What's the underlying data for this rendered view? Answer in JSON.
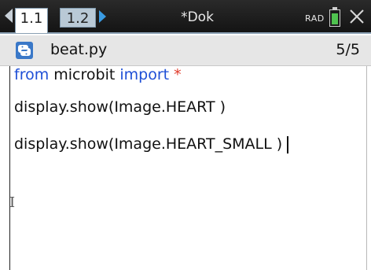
{
  "tabs": [
    {
      "label": "1.1",
      "active": true
    },
    {
      "label": "1.2",
      "active": false
    }
  ],
  "document": {
    "title": "*Dok"
  },
  "status": {
    "angle_mode": "RAD",
    "battery_color": "#4fc24f"
  },
  "file": {
    "icon": "python-icon",
    "name": "beat.py",
    "page_count": "5/5"
  },
  "editor": {
    "line1_keyword_from": "from",
    "line1_module": " microbit ",
    "line1_keyword_import": "import",
    "line1_star": " *",
    "line2": "display.show(Image.HEART )",
    "line3": "display.show(Image.HEART_SMALL )"
  },
  "colors": {
    "keyword": "#1e4fd6",
    "star": "#e03a2a",
    "tab_active_bg": "#ffffff",
    "tab_inactive_bg": "#b9c9d6",
    "nav_arrow_right": "#3a9be3"
  }
}
